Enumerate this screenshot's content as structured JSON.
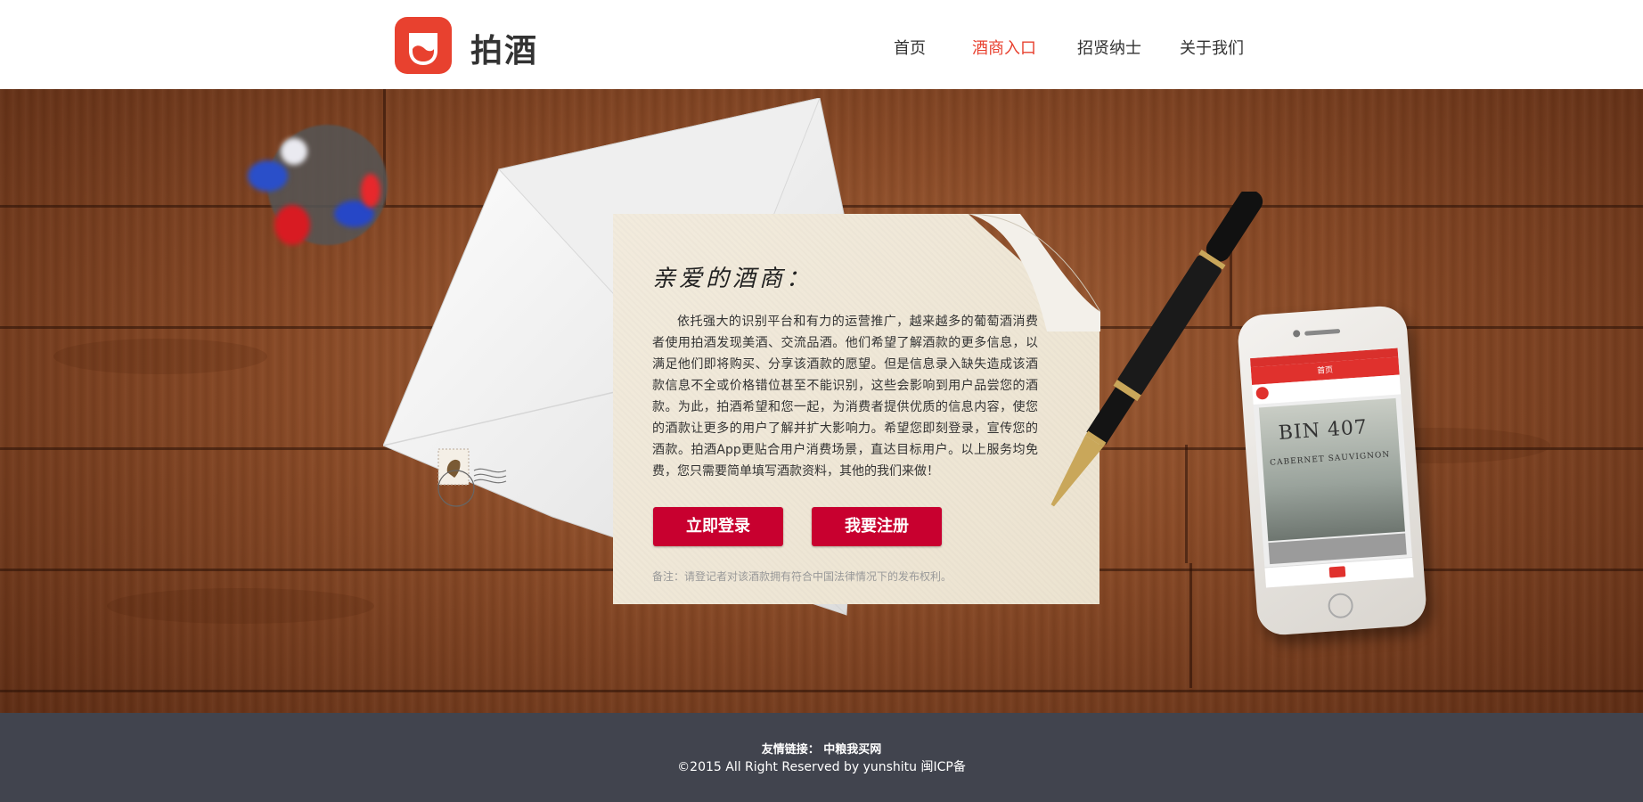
{
  "brand": {
    "name": "拍酒",
    "accent": "#e8412f"
  },
  "nav": {
    "items": [
      {
        "label": "首页",
        "active": false
      },
      {
        "label": "酒商入口",
        "active": true
      },
      {
        "label": "招贤纳士",
        "active": false
      },
      {
        "label": "关于我们",
        "active": false
      }
    ]
  },
  "letter": {
    "greeting": "亲爱的酒商：",
    "body": "依托强大的识别平台和有力的运营推广，越来越多的葡萄酒消费者使用拍酒发现美酒、交流品酒。他们希望了解酒款的更多信息，以满足他们即将购买、分享该酒款的愿望。但是信息录入缺失造成该酒款信息不全或价格错位甚至不能识别，这些会影响到用户品尝您的酒款。为此，拍酒希望和您一起，为消费者提供优质的信息内容，使您的酒款让更多的用户了解并扩大影响力。希望您即刻登录，宣传您的酒款。拍酒App更贴合用户消费场景，直达目标用户。以上服务均免费，您只需要简单填写酒款资料，其他的我们来做！",
    "login_button": "立即登录",
    "register_button": "我要注册",
    "note": "备注：请登记者对该酒款拥有符合中国法律情况下的发布权利。"
  },
  "phone": {
    "screen_title": "首页",
    "wine_title": "BIN 407",
    "wine_subtitle": "CABERNET SAUVIGNON"
  },
  "footer": {
    "links_label": "友情链接：",
    "link_1": "中粮我买网",
    "copyright": "©2015 All Right Reserved by yunshitu 闽ICP备"
  },
  "colors": {
    "button": "#c8002f",
    "footer_bg": "#41444e"
  }
}
